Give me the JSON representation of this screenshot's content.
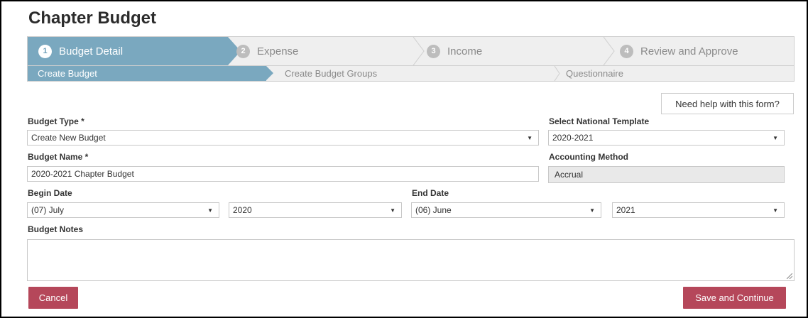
{
  "page": {
    "title": "Chapter Budget"
  },
  "steps": [
    {
      "num": "1",
      "label": "Budget Detail"
    },
    {
      "num": "2",
      "label": "Expense"
    },
    {
      "num": "3",
      "label": "Income"
    },
    {
      "num": "4",
      "label": "Review and Approve"
    }
  ],
  "substeps": [
    {
      "label": "Create Budget"
    },
    {
      "label": "Create Budget Groups"
    },
    {
      "label": "Questionnaire"
    }
  ],
  "help": {
    "label": "Need help with this form?"
  },
  "form": {
    "budget_type": {
      "label": "Budget Type *",
      "value": "Create New Budget"
    },
    "national_template": {
      "label": "Select National Template",
      "value": "2020-2021"
    },
    "budget_name": {
      "label": "Budget Name *",
      "value": "2020-2021 Chapter Budget"
    },
    "accounting_method": {
      "label": "Accounting Method",
      "value": "Accrual"
    },
    "begin_date": {
      "label": "Begin Date",
      "month": "(07) July",
      "year": "2020"
    },
    "end_date": {
      "label": "End Date",
      "month": "(06) June",
      "year": "2021"
    },
    "notes": {
      "label": "Budget Notes",
      "value": ""
    }
  },
  "actions": {
    "cancel": "Cancel",
    "save": "Save and Continue"
  },
  "colors": {
    "accent": "#7aa8bf",
    "danger": "#b5475a"
  }
}
